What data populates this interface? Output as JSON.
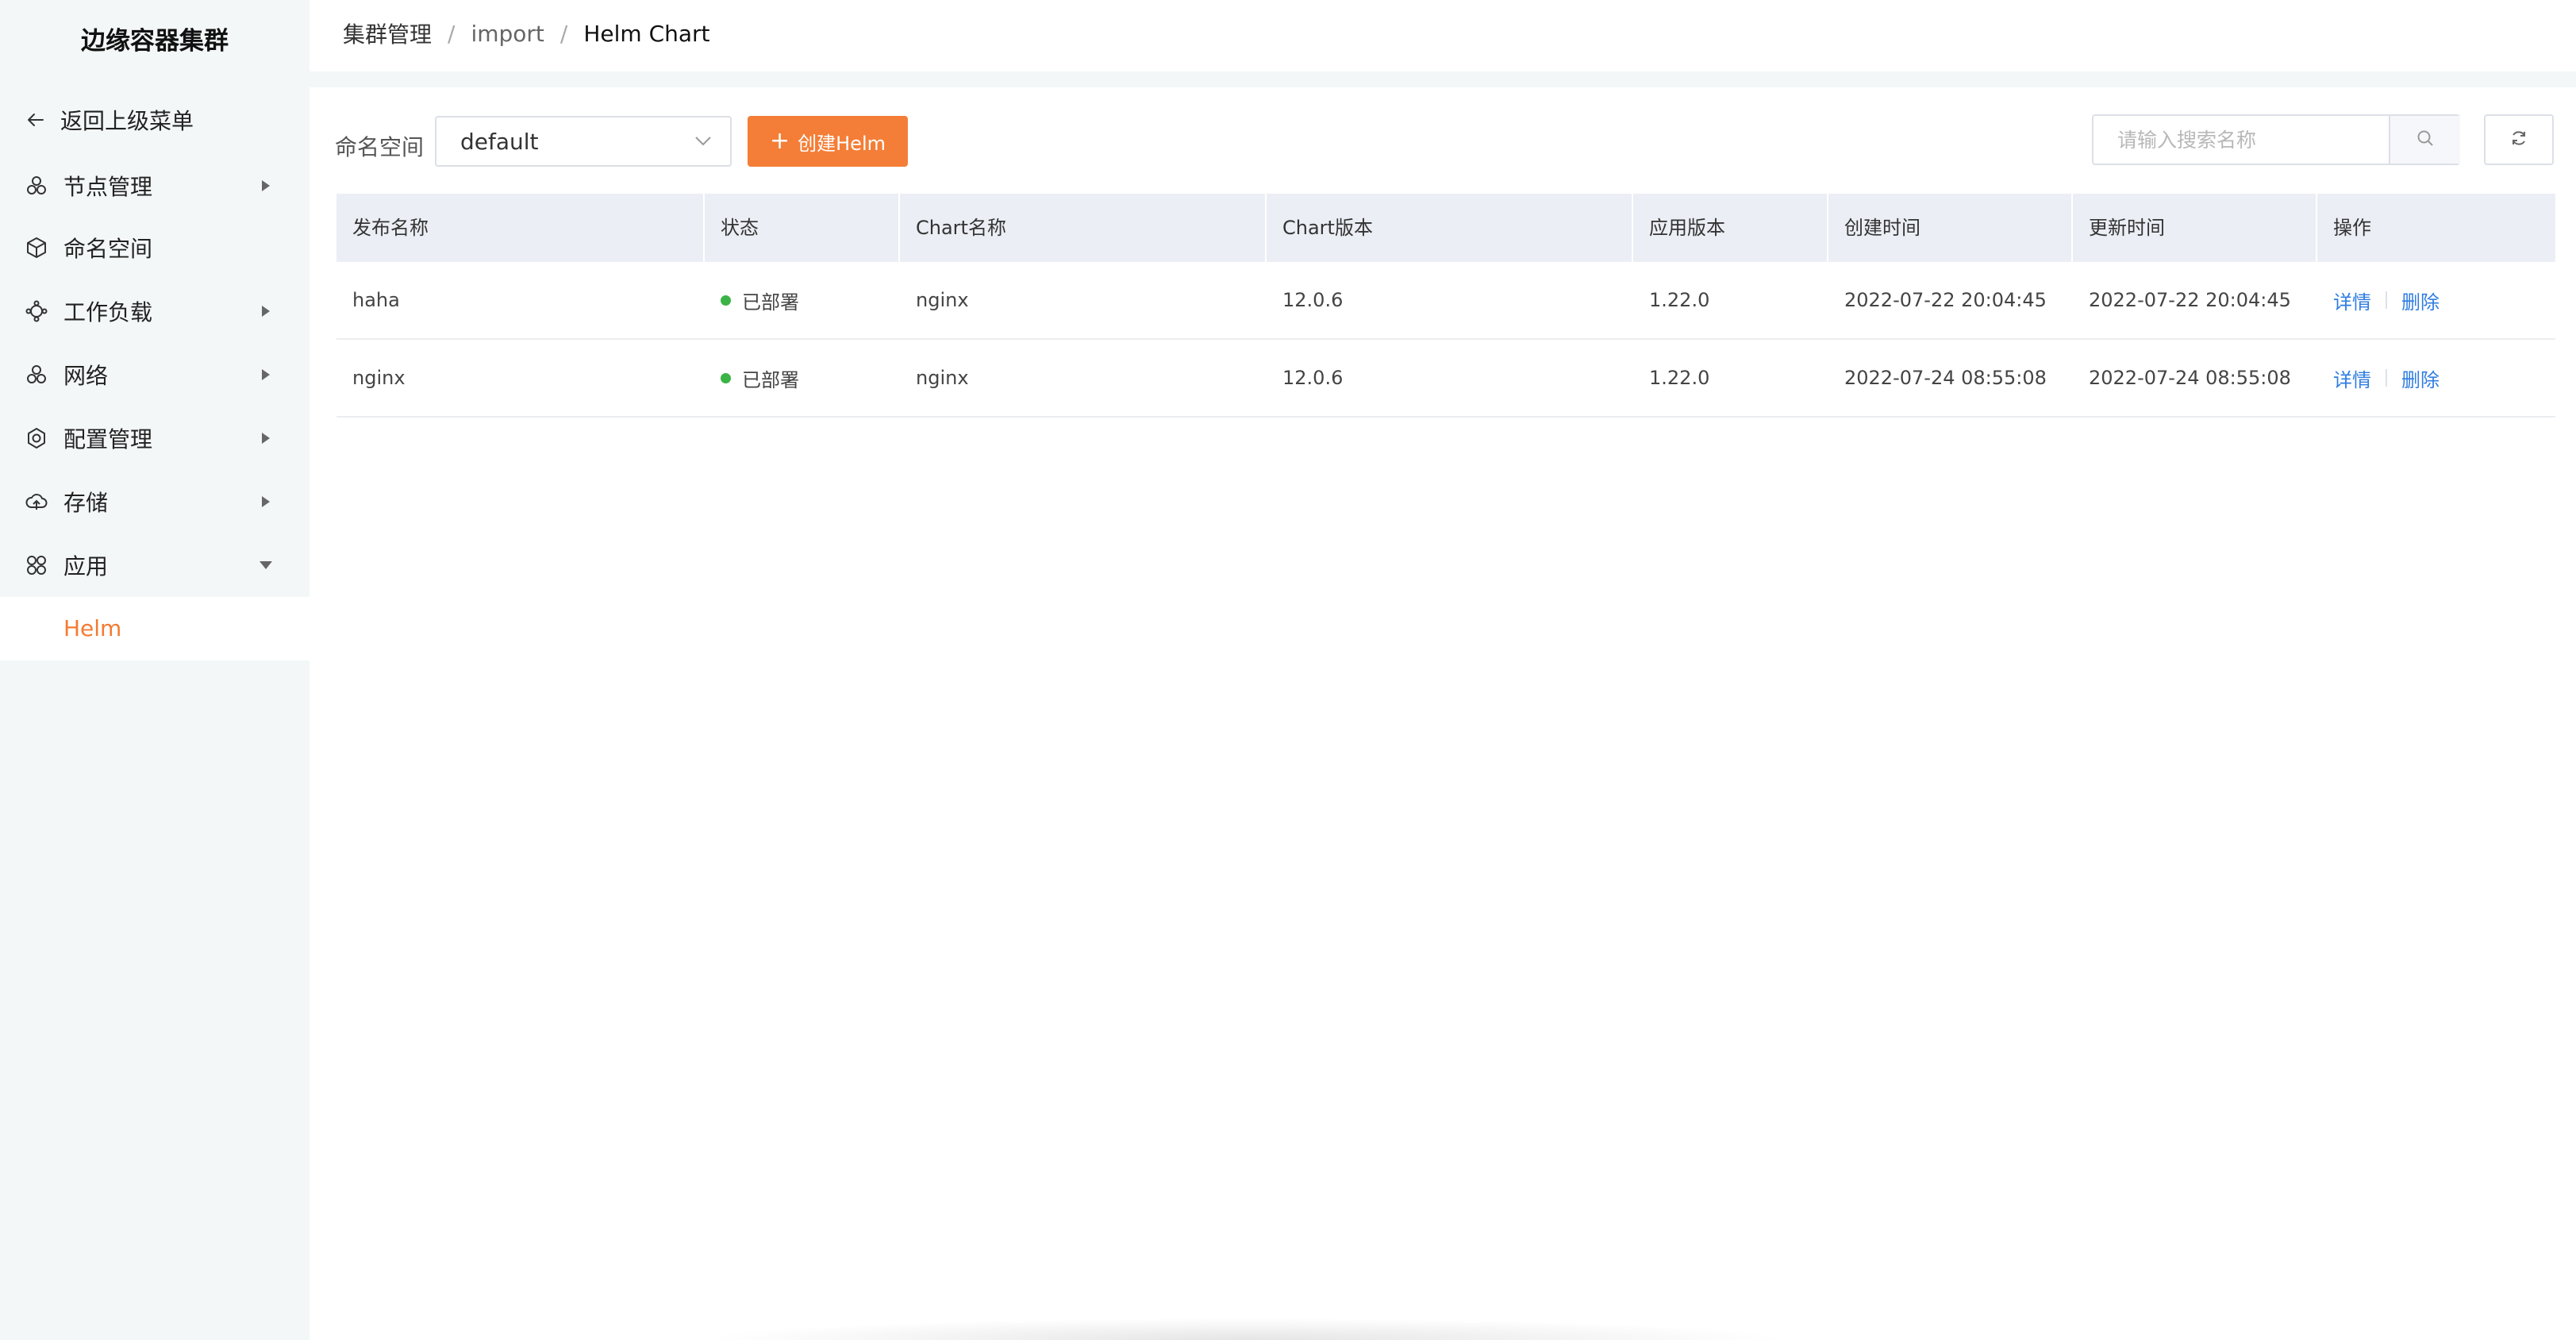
{
  "sidebar": {
    "title": "边缘容器集群",
    "back_label": "返回上级菜单",
    "items": [
      {
        "label": "节点管理",
        "icon": "nodes-icon",
        "has_caret": true
      },
      {
        "label": "命名空间",
        "icon": "namespace-cube-icon",
        "has_caret": false
      },
      {
        "label": "工作负载",
        "icon": "workload-icon",
        "has_caret": true
      },
      {
        "label": "网络",
        "icon": "network-icon",
        "has_caret": true
      },
      {
        "label": "配置管理",
        "icon": "config-gear-icon",
        "has_caret": true
      },
      {
        "label": "存储",
        "icon": "storage-cloud-icon",
        "has_caret": true
      },
      {
        "label": "应用",
        "icon": "apps-icon",
        "has_caret": true,
        "expanded": true
      }
    ],
    "active_subitem": "Helm"
  },
  "breadcrumb": [
    "集群管理",
    "import",
    "Helm Chart"
  ],
  "toolbar": {
    "namespace_label": "命名空间",
    "namespace_value": "default",
    "create_label": "创建Helm",
    "search_placeholder": "请输入搜索名称"
  },
  "table": {
    "columns": [
      "发布名称",
      "状态",
      "Chart名称",
      "Chart版本",
      "应用版本",
      "创建时间",
      "更新时间",
      "操作"
    ],
    "rows": [
      {
        "name": "haha",
        "status": "已部署",
        "chart": "nginx",
        "chart_version": "12.0.6",
        "app_version": "1.22.0",
        "created": "2022-07-22 20:04:45",
        "updated": "2022-07-22 20:04:45"
      },
      {
        "name": "nginx",
        "status": "已部署",
        "chart": "nginx",
        "chart_version": "12.0.6",
        "app_version": "1.22.0",
        "created": "2022-07-24 08:55:08",
        "updated": "2022-07-24 08:55:08"
      }
    ],
    "actions": {
      "detail": "详情",
      "delete": "删除"
    }
  },
  "colors": {
    "accent": "#f47e37",
    "link": "#2f7de1",
    "status_ok": "#3bb346",
    "sidebar_bg": "#f3f7f7"
  }
}
